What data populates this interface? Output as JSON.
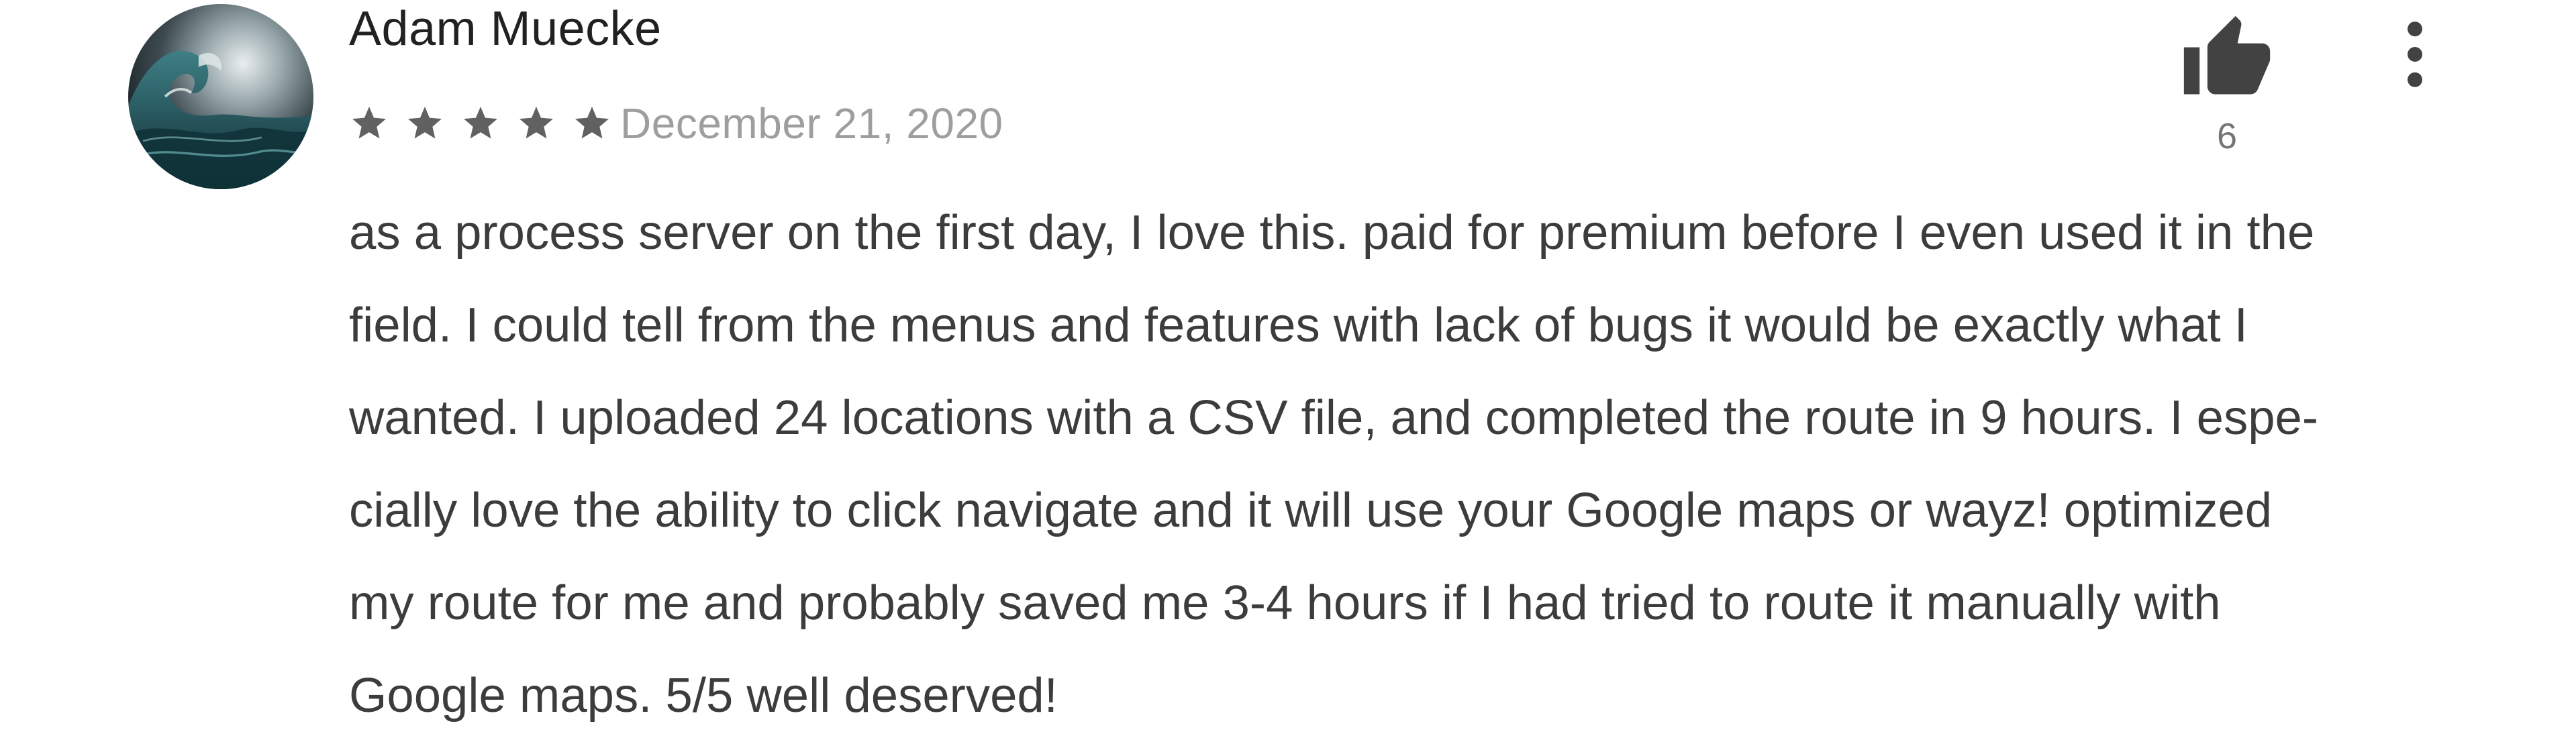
{
  "review": {
    "author": "Adam Muecke",
    "rating": 5,
    "rating_max": 5,
    "date": "December 21, 2020",
    "body": "as a process server on the first day, I love this. paid for premium before I even used it in the\nfield. I could tell from the menus and features with lack of bugs it would be exactly what I\nwanted. I uploaded 24 locations with a CSV file, and completed the route in 9 hours. I espe-\ncially love the ability to click navigate and it will use your Google maps or wayz! optimized\nmy route for me and probably saved me 3-4 hours if I had tried to route it manually with\nGoogle maps. 5/5 well deserved!",
    "helpful_count": "6"
  },
  "icons": {
    "helpful": "thumbs-up-icon",
    "more": "more-vert-icon",
    "star": "star-icon",
    "avatar": "wave-painting-avatar"
  },
  "colors": {
    "star": "#616161",
    "icon": "#424242",
    "author": "#212121",
    "date": "#9e9e9e",
    "body": "#3c3c3c"
  }
}
